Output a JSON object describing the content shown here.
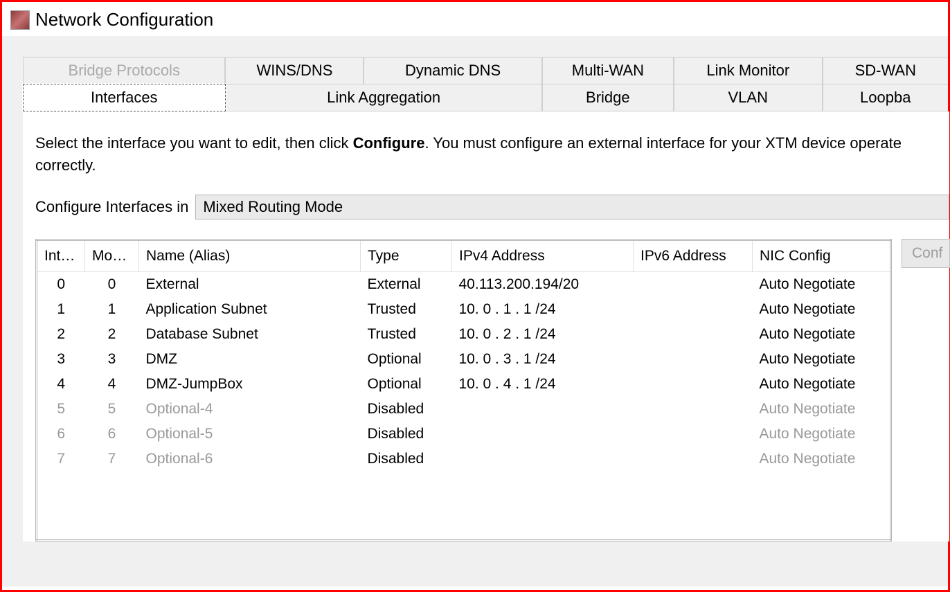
{
  "window": {
    "title": "Network Configuration"
  },
  "tabs": {
    "row1": [
      {
        "label": "Bridge Protocols",
        "disabled": true
      },
      {
        "label": "WINS/DNS"
      },
      {
        "label": "Dynamic DNS"
      },
      {
        "label": "Multi-WAN"
      },
      {
        "label": "Link Monitor"
      },
      {
        "label": "SD-WAN"
      }
    ],
    "row2": [
      {
        "label": "Interfaces",
        "active": true
      },
      {
        "label": "Link Aggregation"
      },
      {
        "label": "Bridge"
      },
      {
        "label": "VLAN"
      },
      {
        "label": "Loopba"
      }
    ]
  },
  "instruction": {
    "pre": "Select the interface you want to edit, then click ",
    "bold": "Configure",
    "post": ". You must configure an external interface for your XTM device operate correctly."
  },
  "configure_label": "Configure Interfaces in",
  "mode_value": "Mixed Routing Mode",
  "table": {
    "headers": {
      "inter": "Inter...",
      "mod": "Mod...",
      "name": "Name (Alias)",
      "type": "Type",
      "ipv4": "IPv4 Address",
      "ipv6": "IPv6 Address",
      "nic": "NIC Config"
    },
    "rows": [
      {
        "inter": "0",
        "mod": "0",
        "name": "External",
        "type": "External",
        "ipv4": "40.113.200.194/20",
        "ipv6": "",
        "nic": "Auto Negotiate",
        "disabled": false
      },
      {
        "inter": "1",
        "mod": "1",
        "name": "Application Subnet",
        "type": "Trusted",
        "ipv4": "10. 0 . 1 . 1 /24",
        "ipv6": "",
        "nic": "Auto Negotiate",
        "disabled": false
      },
      {
        "inter": "2",
        "mod": "2",
        "name": "Database Subnet",
        "type": "Trusted",
        "ipv4": "10. 0 . 2 . 1 /24",
        "ipv6": "",
        "nic": "Auto Negotiate",
        "disabled": false
      },
      {
        "inter": "3",
        "mod": "3",
        "name": "DMZ",
        "type": "Optional",
        "ipv4": "10. 0 . 3 . 1 /24",
        "ipv6": "",
        "nic": "Auto Negotiate",
        "disabled": false
      },
      {
        "inter": "4",
        "mod": "4",
        "name": "DMZ-JumpBox",
        "type": "Optional",
        "ipv4": "10. 0 . 4 . 1 /24",
        "ipv6": "",
        "nic": "Auto Negotiate",
        "disabled": false
      },
      {
        "inter": "5",
        "mod": "5",
        "name": "Optional-4",
        "type": "Disabled",
        "ipv4": "",
        "ipv6": "",
        "nic": "Auto Negotiate",
        "disabled": true
      },
      {
        "inter": "6",
        "mod": "6",
        "name": "Optional-5",
        "type": "Disabled",
        "ipv4": "",
        "ipv6": "",
        "nic": "Auto Negotiate",
        "disabled": true
      },
      {
        "inter": "7",
        "mod": "7",
        "name": "Optional-6",
        "type": "Disabled",
        "ipv4": "",
        "ipv6": "",
        "nic": "Auto Negotiate",
        "disabled": true
      }
    ]
  },
  "side_button": "Conf"
}
